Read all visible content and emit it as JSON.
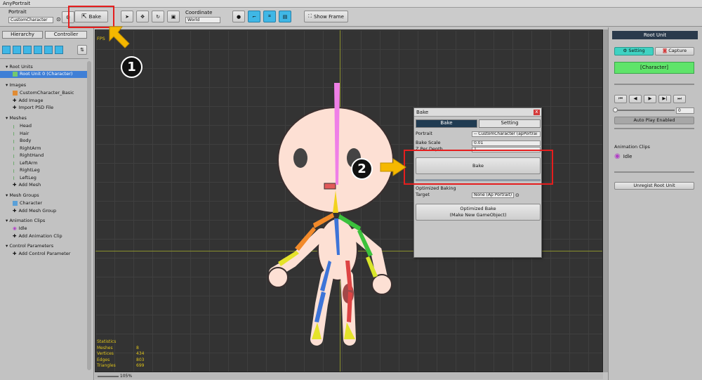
{
  "window": {
    "title": "AnyPortrait"
  },
  "toolbar": {
    "portrait_label": "Portrait",
    "portrait_value": "CustomCharacter",
    "bake_label": "Bake",
    "coordinate_label": "Coordinate",
    "coordinate_value": "World",
    "show_frame_label": "Show Frame"
  },
  "left_panel": {
    "tab_hierarchy": "Hierarchy",
    "tab_controller": "Controller",
    "sections": {
      "root_units": "Root Units",
      "root_unit_item": "Root Unit 0 (Character)",
      "images": "Images",
      "images_items": [
        "CustomCharacter_Basic",
        "Add Image",
        "Import PSD File"
      ],
      "meshes": "Meshes",
      "mesh_items": [
        "Head",
        "Hair",
        "Body",
        "RightArm",
        "RightHand",
        "LeftArm",
        "RightLeg",
        "LeftLeg",
        "Add Mesh"
      ],
      "mesh_groups": "Mesh Groups",
      "mesh_group_items": [
        "Character",
        "Add Mesh Group"
      ],
      "animation_clips": "Animation Clips",
      "animation_items": [
        "Idle",
        "Add Animation Clip"
      ],
      "control_parameters": "Control Parameters",
      "control_items": [
        "Add Control Parameter"
      ]
    }
  },
  "viewport": {
    "fps_label": "FPS",
    "statistics": {
      "title": "Statistics",
      "rows": [
        {
          "label": "Meshes",
          "value": "8"
        },
        {
          "label": "Vertices",
          "value": "434"
        },
        {
          "label": "Edges",
          "value": "803"
        },
        {
          "label": "Triangles",
          "value": "699"
        }
      ]
    },
    "zoom": "105%"
  },
  "bake_dialog": {
    "title": "Bake",
    "close": "x",
    "tab_bake": "Bake",
    "tab_setting": "Setting",
    "portrait_label": "Portrait",
    "portrait_value": "-- CustomCharacter (apPortrai",
    "bake_scale_label": "Bake Scale",
    "bake_scale_value": "0.01",
    "z_per_depth_label": "Z Per Depth",
    "z_per_depth_value": "1",
    "bake_button": "Bake",
    "optimized_baking_label": "Optimized Baking",
    "target_label": "Target",
    "target_value": "None (Ap Portrait)",
    "optimized_bake_button_line1": "Optimized Bake",
    "optimized_bake_button_line2": "(Make New GameObject)"
  },
  "right_panel": {
    "title": "Root Unit",
    "setting_label": "Setting",
    "capture_label": "Capture",
    "character_label": "[Character]",
    "frame_value": "0",
    "auto_play_label": "Auto Play Enabled",
    "animation_clips_label": "Animation Clips",
    "clip_idle": "Idle",
    "unregist_label": "Unregist Root Unit"
  },
  "annotations": {
    "step1": "1",
    "step2": "2"
  },
  "colors": {
    "accent_blue": "#3fb7e6",
    "selection": "#3f7fd6",
    "annotation_red": "#e51e1e",
    "arrow_yellow": "#f5b800",
    "green_panel": "#5fe46a"
  }
}
